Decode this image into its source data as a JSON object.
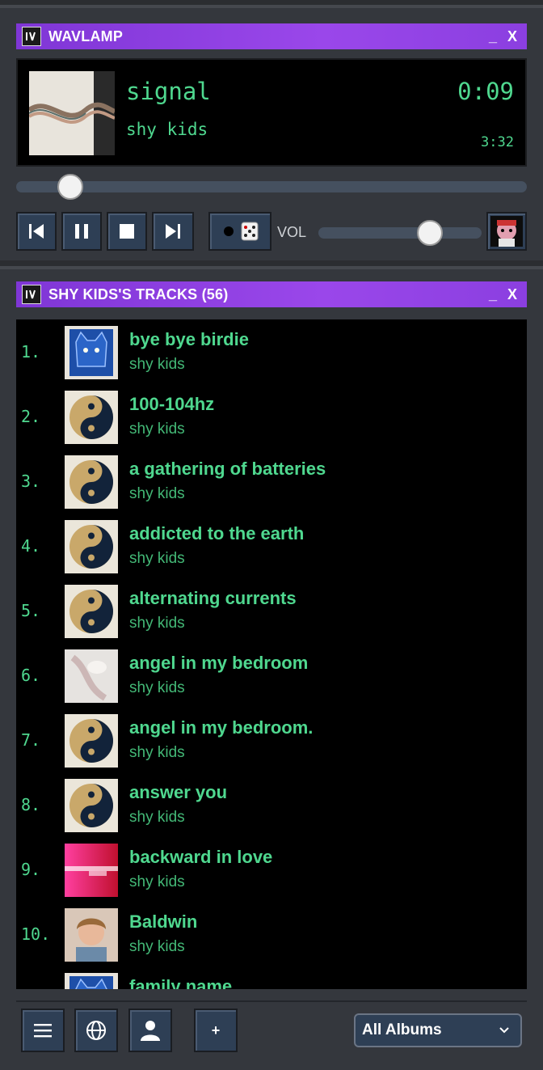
{
  "player": {
    "window_title": "WAVLAMP",
    "window_controls": "_ X",
    "song_title": "signal",
    "song_artist": "shy kids",
    "elapsed": "0:09",
    "duration": "3:32",
    "seek_progress": 0.04,
    "volume_label": "VOL",
    "volume_level": 0.72,
    "buttons": {
      "previous": "skip-back-icon",
      "pause": "pause-icon",
      "stop": "stop-icon",
      "next": "skip-forward-icon",
      "shuffle": "shuffle-dice-icon"
    }
  },
  "playlist": {
    "window_title": "SHY KIDS'S TRACKS (56)",
    "window_controls": "_ X",
    "tracks": [
      {
        "num": "1.",
        "title": "bye bye birdie",
        "artist": "shy kids"
      },
      {
        "num": "2.",
        "title": "100-104hz",
        "artist": "shy kids"
      },
      {
        "num": "3.",
        "title": "a gathering of batteries",
        "artist": "shy kids"
      },
      {
        "num": "4.",
        "title": "addicted to the earth",
        "artist": "shy kids"
      },
      {
        "num": "5.",
        "title": "alternating currents",
        "artist": "shy kids"
      },
      {
        "num": "6.",
        "title": "angel in my bedroom",
        "artist": "shy kids"
      },
      {
        "num": "7.",
        "title": "angel in my bedroom.",
        "artist": "shy kids"
      },
      {
        "num": "8.",
        "title": "answer you",
        "artist": "shy kids"
      },
      {
        "num": "9.",
        "title": "backward in love",
        "artist": "shy kids"
      },
      {
        "num": "10.",
        "title": "Baldwin",
        "artist": "shy kids"
      },
      {
        "num": "",
        "title": "family name",
        "artist": ""
      }
    ],
    "footer": {
      "menu": "menu-icon",
      "globe": "globe-icon",
      "user": "user-icon",
      "add_label": "+",
      "album_select": "All Albums"
    }
  },
  "colors": {
    "accent": "#8a3fe0",
    "text_green": "#4fd88f",
    "button_bg": "#2e3f55"
  }
}
